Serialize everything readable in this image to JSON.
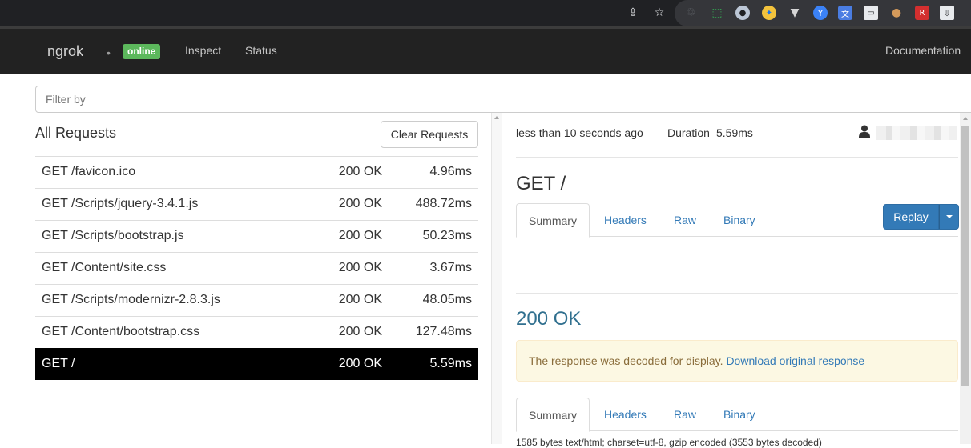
{
  "extensions": [
    "share-icon",
    "star-icon",
    "recycle-icon",
    "screenshot-icon",
    "circle-icon",
    "compass-icon",
    "v-logo-icon",
    "y-logo-icon",
    "translate-icon",
    "window-icon",
    "cookie-icon",
    "r-logo-icon",
    "download-box-icon"
  ],
  "navbar": {
    "brand": "ngrok",
    "dot": "•",
    "status_badge": "online",
    "links": {
      "inspect": "Inspect",
      "status": "Status",
      "documentation": "Documentation"
    }
  },
  "filter": {
    "placeholder": "Filter by",
    "value": ""
  },
  "requests": {
    "title": "All Requests",
    "clear_label": "Clear Requests",
    "rows": [
      {
        "path": "GET /favicon.ico",
        "status": "200 OK",
        "duration": "4.96ms"
      },
      {
        "path": "GET /Scripts/jquery-3.4.1.js",
        "status": "200 OK",
        "duration": "488.72ms"
      },
      {
        "path": "GET /Scripts/bootstrap.js",
        "status": "200 OK",
        "duration": "50.23ms"
      },
      {
        "path": "GET /Content/site.css",
        "status": "200 OK",
        "duration": "3.67ms"
      },
      {
        "path": "GET /Scripts/modernizr-2.8.3.js",
        "status": "200 OK",
        "duration": "48.05ms"
      },
      {
        "path": "GET /Content/bootstrap.css",
        "status": "200 OK",
        "duration": "127.48ms"
      },
      {
        "path": "GET /",
        "status": "200 OK",
        "duration": "5.59ms",
        "selected": true
      }
    ]
  },
  "detail": {
    "time_ago": "less than 10 seconds ago",
    "duration_label": "Duration",
    "duration_value": "5.59ms",
    "request_title": "GET /",
    "request_tabs": {
      "summary": "Summary",
      "headers": "Headers",
      "raw": "Raw",
      "binary": "Binary"
    },
    "replay_label": "Replay",
    "response_status": "200 OK",
    "alert_text": "The response was decoded for display.",
    "alert_link": "Download original response",
    "response_tabs": {
      "summary": "Summary",
      "headers": "Headers",
      "raw": "Raw",
      "binary": "Binary"
    },
    "size_line": "1585 bytes text/html; charset=utf-8, gzip encoded (3553 bytes decoded)"
  },
  "colors": {
    "navbar": "#222222",
    "badge": "#5cb85c",
    "link": "#337ab7",
    "selected_row": "#000000",
    "alert_bg": "#fcf8e3"
  }
}
